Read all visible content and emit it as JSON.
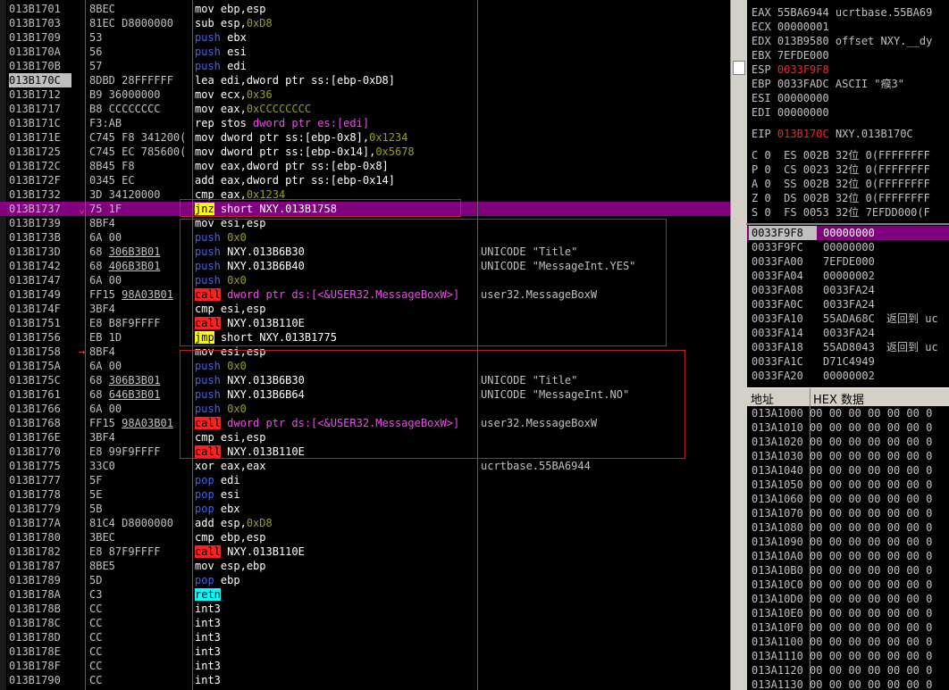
{
  "disasm": [
    {
      "addr": "013B1701",
      "hex": "8BEC",
      "mn": "mov",
      "mnc": "mov",
      "ops": [
        [
          "ebp,esp",
          "ops"
        ]
      ],
      "cmt": ""
    },
    {
      "addr": "013B1703",
      "hex": "81EC D8000000",
      "mn": "sub",
      "mnc": "mov",
      "ops": [
        [
          "esp,",
          "ops"
        ],
        [
          "0xD8",
          "imm"
        ]
      ],
      "cmt": ""
    },
    {
      "addr": "013B1709",
      "hex": "53",
      "mn": "push",
      "mnc": "push",
      "ops": [
        [
          "ebx",
          "ops"
        ]
      ],
      "cmt": ""
    },
    {
      "addr": "013B170A",
      "hex": "56",
      "mn": "push",
      "mnc": "push",
      "ops": [
        [
          "esi",
          "ops"
        ]
      ],
      "cmt": ""
    },
    {
      "addr": "013B170B",
      "hex": "57",
      "mn": "push",
      "mnc": "push",
      "ops": [
        [
          "edi",
          "ops"
        ]
      ],
      "cmt": ""
    },
    {
      "addr": "013B170C",
      "hex": "8DBD 28FFFFFF",
      "mn": "lea",
      "mnc": "mov",
      "ops": [
        [
          "edi,dword ptr ss:[ebp-0xD8]",
          "ops"
        ]
      ],
      "cmt": "",
      "eip": true
    },
    {
      "addr": "013B1712",
      "hex": "B9 36000000",
      "mn": "mov",
      "mnc": "mov",
      "ops": [
        [
          "ecx,",
          "ops"
        ],
        [
          "0x36",
          "imm"
        ]
      ],
      "cmt": ""
    },
    {
      "addr": "013B1717",
      "hex": "B8 CCCCCCCC",
      "mn": "mov",
      "mnc": "mov",
      "ops": [
        [
          "eax,",
          "ops"
        ],
        [
          "0xCCCCCCCC",
          "imm"
        ]
      ],
      "cmt": ""
    },
    {
      "addr": "013B171C",
      "hex": "F3:AB",
      "mn": "rep stos",
      "mnc": "mov",
      "ops": [
        [
          "dword ptr es:[edi]",
          "memp"
        ]
      ],
      "cmt": ""
    },
    {
      "addr": "013B171E",
      "hex": "C745 F8 341200(",
      "mn": "mov",
      "mnc": "mov",
      "ops": [
        [
          "dword ptr ss:[ebp-0x8],",
          "ops"
        ],
        [
          "0x1234",
          "imm"
        ]
      ],
      "cmt": ""
    },
    {
      "addr": "013B1725",
      "hex": "C745 EC 785600(",
      "mn": "mov",
      "mnc": "mov",
      "ops": [
        [
          "dword ptr ss:[ebp-0x14],",
          "ops"
        ],
        [
          "0x5678",
          "imm"
        ]
      ],
      "cmt": ""
    },
    {
      "addr": "013B172C",
      "hex": "8B45 F8",
      "mn": "mov",
      "mnc": "mov",
      "ops": [
        [
          "eax,dword ptr ss:[ebp-0x8]",
          "ops"
        ]
      ],
      "cmt": ""
    },
    {
      "addr": "013B172F",
      "hex": "0345 EC",
      "mn": "add",
      "mnc": "mov",
      "ops": [
        [
          "eax,dword ptr ss:[ebp-0x14]",
          "ops"
        ]
      ],
      "cmt": ""
    },
    {
      "addr": "013B1732",
      "hex": "3D 34120000",
      "mn": "cmp",
      "mnc": "mov",
      "ops": [
        [
          "eax,",
          "ops"
        ],
        [
          "0x1234",
          "imm"
        ]
      ],
      "cmt": ""
    },
    {
      "addr": "013B1737",
      "hex": "75 1F",
      "mn": "jnz",
      "mnc": "jcc",
      "ops": [
        [
          "short NXY.013B1758",
          "ops"
        ]
      ],
      "cmt": "",
      "hl": true,
      "jmp": "v"
    },
    {
      "addr": "013B1739",
      "hex": "8BF4",
      "mn": "mov",
      "mnc": "mov",
      "ops": [
        [
          "esi,esp",
          "ops"
        ]
      ],
      "cmt": ""
    },
    {
      "addr": "013B173B",
      "hex": "6A 00",
      "mn": "push",
      "mnc": "push",
      "ops": [
        [
          "0x0",
          "imm"
        ]
      ],
      "cmt": ""
    },
    {
      "addr": "013B173D",
      "hex": "68 306B3B01",
      "hexu": true,
      "mn": "push",
      "mnc": "push",
      "ops": [
        [
          "NXY.013B6B30",
          "ops"
        ]
      ],
      "cmt": "UNICODE \"Title\""
    },
    {
      "addr": "013B1742",
      "hex": "68 406B3B01",
      "hexu": true,
      "mn": "push",
      "mnc": "push",
      "ops": [
        [
          "NXY.013B6B40",
          "ops"
        ]
      ],
      "cmt": "UNICODE \"MessageInt.YES\""
    },
    {
      "addr": "013B1747",
      "hex": "6A 00",
      "mn": "push",
      "mnc": "push",
      "ops": [
        [
          "0x0",
          "imm"
        ]
      ],
      "cmt": ""
    },
    {
      "addr": "013B1749",
      "hex": "FF15 98A03B01",
      "hexu": true,
      "mn": "call",
      "mnc": "call",
      "ops": [
        [
          "dword ptr ds:[<&USER32.MessageBoxW>]",
          "memp"
        ]
      ],
      "cmt": "user32.MessageBoxW"
    },
    {
      "addr": "013B174F",
      "hex": "3BF4",
      "mn": "cmp",
      "mnc": "mov",
      "ops": [
        [
          "esi,esp",
          "ops"
        ]
      ],
      "cmt": ""
    },
    {
      "addr": "013B1751",
      "hex": "E8 B8F9FFFF",
      "mn": "call",
      "mnc": "call",
      "ops": [
        [
          "NXY.013B110E",
          "ops"
        ]
      ],
      "cmt": ""
    },
    {
      "addr": "013B1756",
      "hex": "EB 1D",
      "mn": "jmp",
      "mnc": "jcc",
      "ops": [
        [
          "short NXY.013B1775",
          "ops"
        ]
      ],
      "cmt": ""
    },
    {
      "addr": "013B1758",
      "hex": "8BF4",
      "mn": "mov",
      "mnc": "mov",
      "ops": [
        [
          "esi,esp",
          "ops"
        ]
      ],
      "cmt": "",
      "jmp": ">"
    },
    {
      "addr": "013B175A",
      "hex": "6A 00",
      "mn": "push",
      "mnc": "push",
      "ops": [
        [
          "0x0",
          "imm"
        ]
      ],
      "cmt": ""
    },
    {
      "addr": "013B175C",
      "hex": "68 306B3B01",
      "hexu": true,
      "mn": "push",
      "mnc": "push",
      "ops": [
        [
          "NXY.013B6B30",
          "ops"
        ]
      ],
      "cmt": "UNICODE \"Title\""
    },
    {
      "addr": "013B1761",
      "hex": "68 646B3B01",
      "hexu": true,
      "mn": "push",
      "mnc": "push",
      "ops": [
        [
          "NXY.013B6B64",
          "ops"
        ]
      ],
      "cmt": "UNICODE \"MessageInt.NO\""
    },
    {
      "addr": "013B1766",
      "hex": "6A 00",
      "mn": "push",
      "mnc": "push",
      "ops": [
        [
          "0x0",
          "imm"
        ]
      ],
      "cmt": ""
    },
    {
      "addr": "013B1768",
      "hex": "FF15 98A03B01",
      "hexu": true,
      "mn": "call",
      "mnc": "call",
      "ops": [
        [
          "dword ptr ds:[<&USER32.MessageBoxW>]",
          "memp"
        ]
      ],
      "cmt": "user32.MessageBoxW"
    },
    {
      "addr": "013B176E",
      "hex": "3BF4",
      "mn": "cmp",
      "mnc": "mov",
      "ops": [
        [
          "esi,esp",
          "ops"
        ]
      ],
      "cmt": ""
    },
    {
      "addr": "013B1770",
      "hex": "E8 99F9FFFF",
      "mn": "call",
      "mnc": "call",
      "ops": [
        [
          "NXY.013B110E",
          "ops"
        ]
      ],
      "cmt": ""
    },
    {
      "addr": "013B1775",
      "hex": "33C0",
      "mn": "xor",
      "mnc": "mov",
      "ops": [
        [
          "eax,eax",
          "ops"
        ]
      ],
      "cmt": "ucrtbase.55BA6944"
    },
    {
      "addr": "013B1777",
      "hex": "5F",
      "mn": "pop",
      "mnc": "pop",
      "ops": [
        [
          "edi",
          "ops"
        ]
      ],
      "cmt": ""
    },
    {
      "addr": "013B1778",
      "hex": "5E",
      "mn": "pop",
      "mnc": "pop",
      "ops": [
        [
          "esi",
          "ops"
        ]
      ],
      "cmt": ""
    },
    {
      "addr": "013B1779",
      "hex": "5B",
      "mn": "pop",
      "mnc": "pop",
      "ops": [
        [
          "ebx",
          "ops"
        ]
      ],
      "cmt": ""
    },
    {
      "addr": "013B177A",
      "hex": "81C4 D8000000",
      "mn": "add",
      "mnc": "mov",
      "ops": [
        [
          "esp,",
          "ops"
        ],
        [
          "0xD8",
          "imm"
        ]
      ],
      "cmt": ""
    },
    {
      "addr": "013B1780",
      "hex": "3BEC",
      "mn": "cmp",
      "mnc": "mov",
      "ops": [
        [
          "ebp,esp",
          "ops"
        ]
      ],
      "cmt": ""
    },
    {
      "addr": "013B1782",
      "hex": "E8 87F9FFFF",
      "mn": "call",
      "mnc": "call",
      "ops": [
        [
          "NXY.013B110E",
          "ops"
        ]
      ],
      "cmt": ""
    },
    {
      "addr": "013B1787",
      "hex": "8BE5",
      "mn": "mov",
      "mnc": "mov",
      "ops": [
        [
          "esp,ebp",
          "ops"
        ]
      ],
      "cmt": ""
    },
    {
      "addr": "013B1789",
      "hex": "5D",
      "mn": "pop",
      "mnc": "pop",
      "ops": [
        [
          "ebp",
          "ops"
        ]
      ],
      "cmt": ""
    },
    {
      "addr": "013B178A",
      "hex": "C3",
      "mn": "retn",
      "mnc": "retn",
      "ops": [],
      "cmt": ""
    },
    {
      "addr": "013B178B",
      "hex": "CC",
      "mn": "int3",
      "mnc": "mov",
      "ops": [],
      "cmt": ""
    },
    {
      "addr": "013B178C",
      "hex": "CC",
      "mn": "int3",
      "mnc": "mov",
      "ops": [],
      "cmt": ""
    },
    {
      "addr": "013B178D",
      "hex": "CC",
      "mn": "int3",
      "mnc": "mov",
      "ops": [],
      "cmt": ""
    },
    {
      "addr": "013B178E",
      "hex": "CC",
      "mn": "int3",
      "mnc": "mov",
      "ops": [],
      "cmt": ""
    },
    {
      "addr": "013B178F",
      "hex": "CC",
      "mn": "int3",
      "mnc": "mov",
      "ops": [],
      "cmt": ""
    },
    {
      "addr": "013B1790",
      "hex": "CC",
      "mn": "int3",
      "mnc": "mov",
      "ops": [],
      "cmt": ""
    }
  ],
  "registers": {
    "eax": "EAX 55BA6944 ucrtbase.55BA69",
    "ecx": "ECX 00000001",
    "edx": "EDX 013B9580 offset NXY.__dy",
    "ebx": "EBX 7EFDE000",
    "esp_label": "ESP",
    "esp_val": "0033F9F8",
    "ebp": "EBP 0033FADC ASCII \"瘊3\"",
    "esi": "ESI 00000000",
    "edi": "EDI 00000000",
    "eip_label": "EIP",
    "eip_val": "013B170C",
    "eip_cmt": "NXY.013B170C",
    "flags": [
      "C 0  ES 002B 32位 0(FFFFFFFF",
      "P 0  CS 0023 32位 0(FFFFFFFF",
      "A 0  SS 002B 32位 0(FFFFFFFF",
      "Z 0  DS 002B 32位 0(FFFFFFFF",
      "S 0  FS 0053 32位 7EFDD000(F"
    ]
  },
  "stack": [
    {
      "a": "0033F9F8",
      "v": "00000000",
      "c": "",
      "sel": true
    },
    {
      "a": "0033F9FC",
      "v": "00000000",
      "c": ""
    },
    {
      "a": "0033FA00",
      "v": "7EFDE000",
      "c": ""
    },
    {
      "a": "0033FA04",
      "v": "00000002",
      "c": ""
    },
    {
      "a": "0033FA08",
      "v": "0033FA24",
      "c": ""
    },
    {
      "a": "0033FA0C",
      "v": "0033FA24",
      "c": ""
    },
    {
      "a": "0033FA10",
      "v": "55ADA68C",
      "c": "返回到 uc"
    },
    {
      "a": "0033FA14",
      "v": "0033FA24",
      "c": ""
    },
    {
      "a": "0033FA18",
      "v": "55AD8043",
      "c": "返回到 uc"
    },
    {
      "a": "0033FA1C",
      "v": "D71C4949",
      "c": ""
    },
    {
      "a": "0033FA20",
      "v": "00000002",
      "c": ""
    }
  ],
  "dump": {
    "col_addr": "地址",
    "col_hex": "HEX 数据",
    "rows": [
      "013A1000 00 00 00 00 00 00 0",
      "013A1010 00 00 00 00 00 00 0",
      "013A1020 00 00 00 00 00 00 0",
      "013A1030 00 00 00 00 00 00 0",
      "013A1040 00 00 00 00 00 00 0",
      "013A1050 00 00 00 00 00 00 0",
      "013A1060 00 00 00 00 00 00 0",
      "013A1070 00 00 00 00 00 00 0",
      "013A1080 00 00 00 00 00 00 0",
      "013A1090 00 00 00 00 00 00 0",
      "013A10A0 00 00 00 00 00 00 0",
      "013A10B0 00 00 00 00 00 00 0",
      "013A10C0 00 00 00 00 00 00 0",
      "013A10D0 00 00 00 00 00 00 0",
      "013A10E0 00 00 00 00 00 00 0",
      "013A10F0 00 00 00 00 00 00 0",
      "013A1100 00 00 00 00 00 00 0",
      "013A1110 00 00 00 00 00 00 0",
      "013A1120 00 00 00 00 00 00 0",
      "013A1130 00 00 00 00 00 00 0"
    ]
  },
  "colors": {
    "highlight": "#800080",
    "call_bg": "#ff2020",
    "jcc_bg": "#ffff00",
    "retn_bg": "#00ffff",
    "push_pop": "#4060ff",
    "immediate": "#a0a000"
  }
}
